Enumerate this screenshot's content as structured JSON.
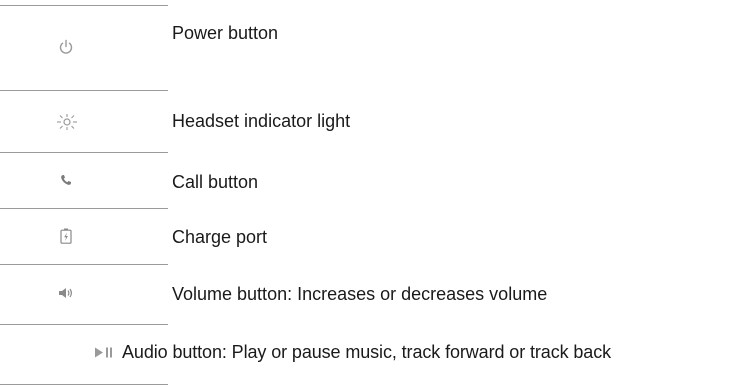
{
  "rows": [
    {
      "icon": "power-icon",
      "label": "Power button"
    },
    {
      "icon": "indicator-light-icon",
      "label": "Headset indicator light"
    },
    {
      "icon": "phone-icon",
      "label": "Call button"
    },
    {
      "icon": "charge-port-icon",
      "label": "Charge port"
    },
    {
      "icon": "volume-icon",
      "label": "Volume button: Increases or decreases volume"
    },
    {
      "icon": "play-pause-icon",
      "label": "Audio button: Play or pause music, track forward or track back"
    }
  ],
  "colors": {
    "rule": "#9a9a9a",
    "icon": "#9a9a9a",
    "text": "#1a1a1a"
  }
}
